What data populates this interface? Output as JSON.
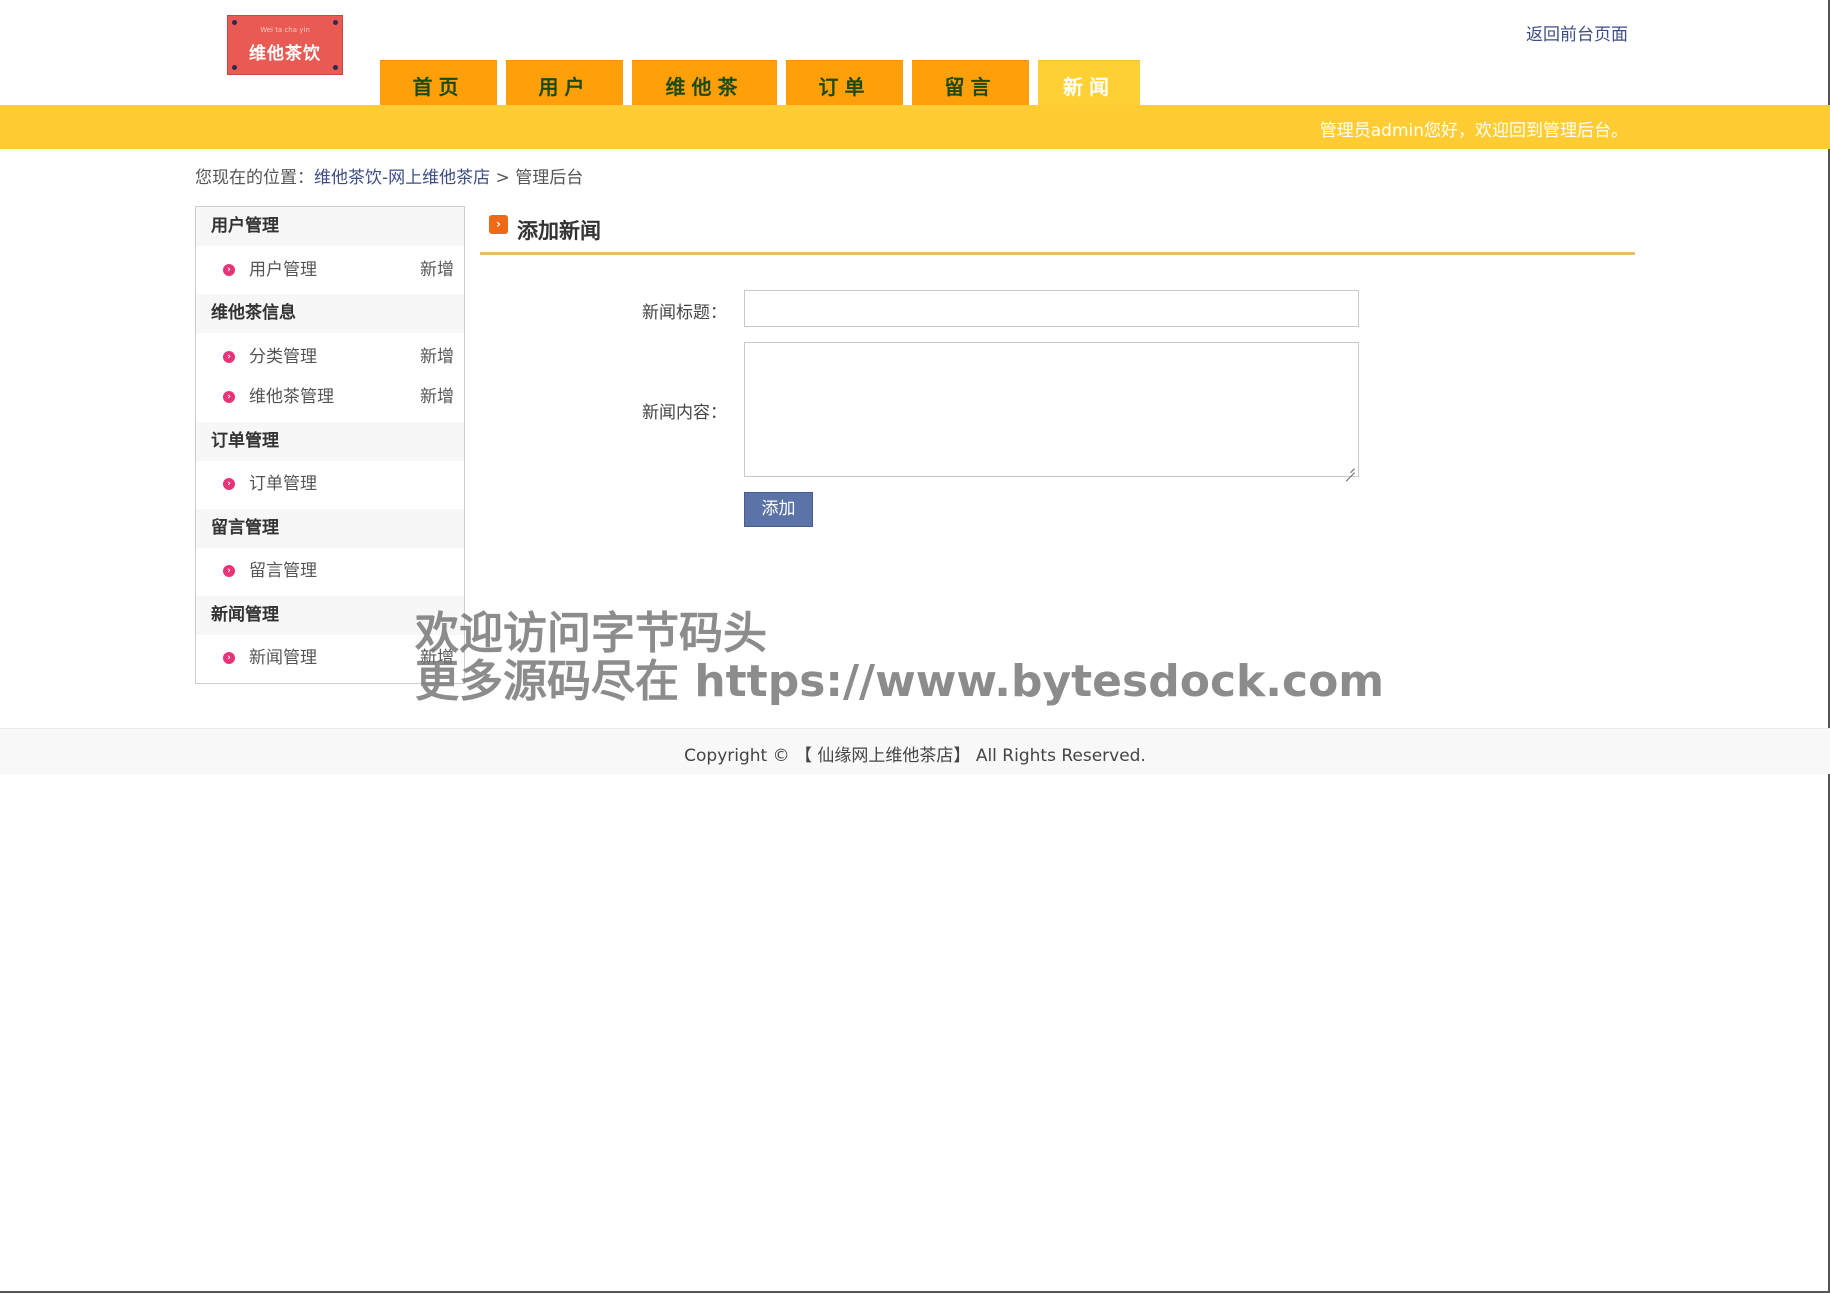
{
  "header": {
    "logo_small": "Wei ta cha yin",
    "logo_main": "维他茶饮",
    "back_link": "返回前台页面",
    "welcome": "管理员admin您好，欢迎回到管理后台。"
  },
  "nav": {
    "tabs": [
      {
        "label": "首页",
        "active": false
      },
      {
        "label": "用户",
        "active": false
      },
      {
        "label": "维他茶",
        "active": false
      },
      {
        "label": "订单",
        "active": false
      },
      {
        "label": "留言",
        "active": false
      },
      {
        "label": "新闻",
        "active": true
      }
    ]
  },
  "breadcrumb": {
    "prefix": "您现在的位置：",
    "site": "维他茶饮-网上维他茶店",
    "sep": " > ",
    "current": "管理后台"
  },
  "sidebar": {
    "groups": [
      {
        "title": "用户管理",
        "items": [
          {
            "label": "用户管理",
            "action": "新增"
          }
        ]
      },
      {
        "title": "维他茶信息",
        "items": [
          {
            "label": "分类管理",
            "action": "新增"
          },
          {
            "label": "维他茶管理",
            "action": "新增"
          }
        ]
      },
      {
        "title": "订单管理",
        "items": [
          {
            "label": "订单管理",
            "action": ""
          }
        ]
      },
      {
        "title": "留言管理",
        "items": [
          {
            "label": "留言管理",
            "action": ""
          }
        ]
      },
      {
        "title": "新闻管理",
        "items": [
          {
            "label": "新闻管理",
            "action": "新增"
          }
        ]
      }
    ]
  },
  "main": {
    "title": "添加新闻",
    "form": {
      "title_label": "新闻标题：",
      "title_value": "",
      "content_label": "新闻内容：",
      "content_value": "",
      "submit_label": "添加"
    }
  },
  "watermark": {
    "line1": "欢迎访问字节码头",
    "line2": "更多源码尽在  https://www.bytesdock.com"
  },
  "footer": {
    "copyright": "Copyright © 【 仙缘网上维他茶店】 All Rights Reserved."
  },
  "colors": {
    "nav_tab": "#ff9f0a",
    "nav_active": "#ffd033",
    "bar": "#ffcd33",
    "button": "#5c73a8",
    "link": "#3d4d86"
  }
}
